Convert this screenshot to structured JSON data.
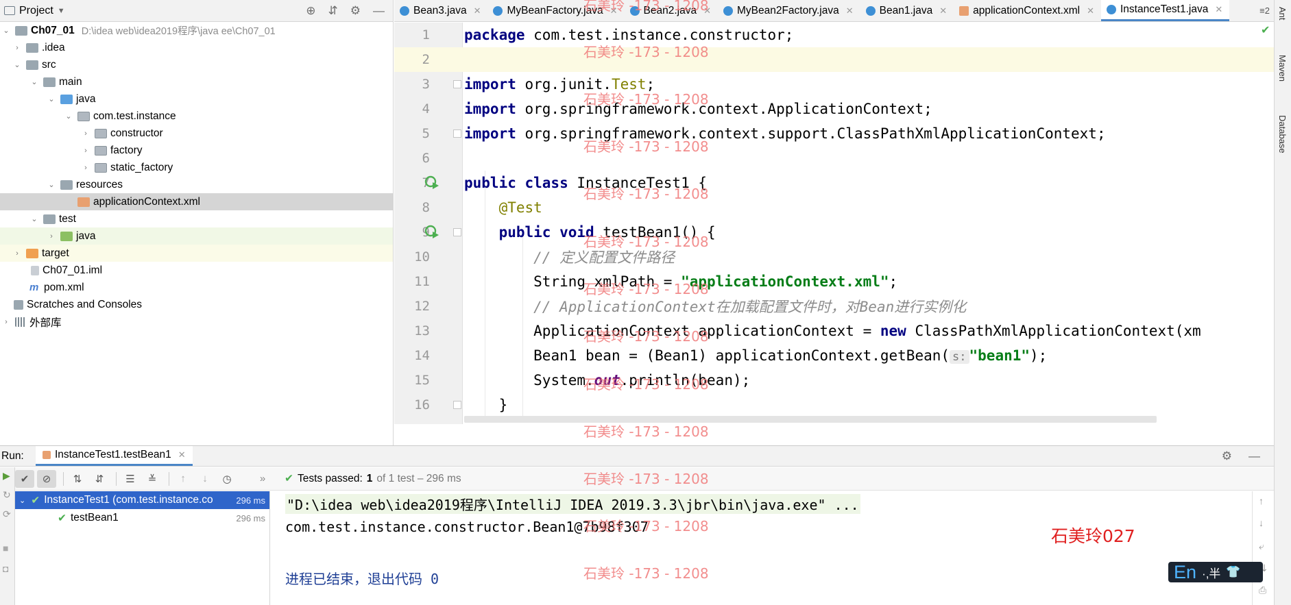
{
  "project_panel": {
    "title": "Project",
    "tree": [
      {
        "label": "Ch07_01",
        "path": "D:\\idea web\\idea2019程序\\java ee\\Ch07_01"
      },
      {
        "label": ".idea"
      },
      {
        "label": "src"
      },
      {
        "label": "main"
      },
      {
        "label": "java"
      },
      {
        "label": "com.test.instance"
      },
      {
        "label": "constructor"
      },
      {
        "label": "factory"
      },
      {
        "label": "static_factory"
      },
      {
        "label": "resources"
      },
      {
        "label": "applicationContext.xml"
      },
      {
        "label": "test"
      },
      {
        "label": "java"
      },
      {
        "label": "target"
      },
      {
        "label": "Ch07_01.iml"
      },
      {
        "label": "pom.xml"
      },
      {
        "label": "Scratches and Consoles"
      },
      {
        "label": "外部库"
      }
    ]
  },
  "editor_tabs": [
    {
      "label": "Bean3.java"
    },
    {
      "label": "MyBeanFactory.java"
    },
    {
      "label": "Bean2.java"
    },
    {
      "label": "MyBean2Factory.java"
    },
    {
      "label": "Bean1.java"
    },
    {
      "label": "applicationContext.xml"
    },
    {
      "label": "InstanceTest1.java"
    }
  ],
  "tabs_overflow": "≡2",
  "editor": {
    "line_numbers": [
      "1",
      "2",
      "3",
      "4",
      "5",
      "6",
      "7",
      "8",
      "9",
      "10",
      "11",
      "12",
      "13",
      "14",
      "15",
      "16"
    ],
    "code": {
      "l1_kw": "package",
      "l1_rest": " com.test.instance.constructor;",
      "l3_kw": "import",
      "l3_a": " org.junit.",
      "l3_ann": "Test",
      "l3_b": ";",
      "l4_kw": "import",
      "l4_rest": " org.springframework.context.ApplicationContext;",
      "l5_kw": "import",
      "l5_rest": " org.springframework.context.support.ClassPathXmlApplicationContext;",
      "l7_kw": "public class",
      "l7_rest": " InstanceTest1 {",
      "l8_ann": "@Test",
      "l9_kw": "public void",
      "l9_rest": " testBean1() {",
      "l10_cmt": "// 定义配置文件路径",
      "l11_a": "String xmlPath = ",
      "l11_str": "\"applicationContext.xml\"",
      "l11_b": ";",
      "l12_cmt": "// ApplicationContext在加载配置文件时，对Bean进行实例化",
      "l13_a": "ApplicationContext applicationContext = ",
      "l13_kw": "new",
      "l13_b": " ClassPathXmlApplicationContext(xm",
      "l14_a": "Bean1 bean = (Bean1) applicationContext.getBean(",
      "l14_hint": "s:",
      "l14_str": "\"bean1\"",
      "l14_b": ");",
      "l15_a": "System.",
      "l15_fld": "out",
      "l15_b": ".println(bean);",
      "l16": "}"
    }
  },
  "right_strip": [
    "Ant",
    "Maven",
    "Database"
  ],
  "run_panel": {
    "label": "Run:",
    "tab": "InstanceTest1.testBean1",
    "status_bold": "Tests passed:",
    "status_count": "1",
    "status_rest": "of 1 test – 296 ms",
    "test_tree": [
      {
        "label": "InstanceTest1 (com.test.instance.co",
        "duration": "296 ms"
      },
      {
        "label": "testBean1",
        "duration": "296 ms"
      }
    ],
    "console": [
      "\"D:\\idea web\\idea2019程序\\IntelliJ IDEA 2019.3.3\\jbr\\bin\\java.exe\" ...",
      "com.test.instance.constructor.Bean1@7b98f307",
      "进程已结束，退出代码 0"
    ]
  },
  "watermark": "石美玲 -173 - 1208",
  "signature": "石美玲027",
  "ime": {
    "lang": "En",
    "rest": "·,半"
  }
}
